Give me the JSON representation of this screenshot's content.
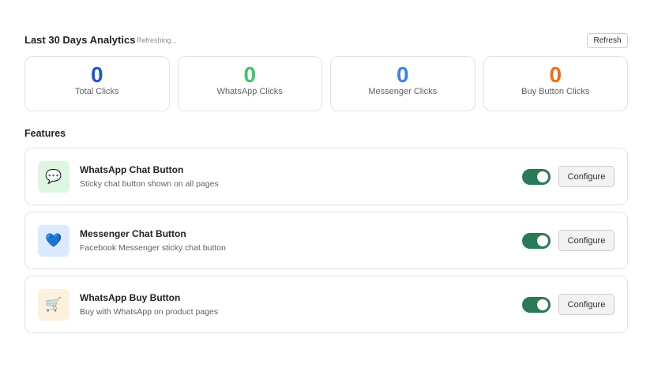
{
  "analytics": {
    "title": "Last 30 Days Analytics",
    "status": "Refreshing...",
    "refresh_label": "Refresh",
    "stats": [
      {
        "value": "0",
        "label": "Total Clicks",
        "color": "#1f55d4"
      },
      {
        "value": "0",
        "label": "WhatsApp Clicks",
        "color": "#3fc46a"
      },
      {
        "value": "0",
        "label": "Messenger Clicks",
        "color": "#3b82e6"
      },
      {
        "value": "0",
        "label": "Buy Button Clicks",
        "color": "#f26c12"
      }
    ]
  },
  "features": {
    "title": "Features",
    "items": [
      {
        "title": "WhatsApp Chat Button",
        "description": "Sticky chat button shown on all pages",
        "icon": "speech-bubble-icon",
        "icon_glyph": "💬",
        "icon_bg": "#dff6e3",
        "enabled": true,
        "configure_label": "Configure"
      },
      {
        "title": "Messenger Chat Button",
        "description": "Facebook Messenger sticky chat button",
        "icon": "blue-heart-icon",
        "icon_glyph": "💙",
        "icon_bg": "#dbeafd",
        "enabled": true,
        "configure_label": "Configure"
      },
      {
        "title": "WhatsApp Buy Button",
        "description": "Buy with WhatsApp on product pages",
        "icon": "shopping-cart-icon",
        "icon_glyph": "🛒",
        "icon_bg": "#fdf0dc",
        "enabled": true,
        "configure_label": "Configure"
      }
    ]
  },
  "colors": {
    "toggle_on": "#2b7a57"
  }
}
